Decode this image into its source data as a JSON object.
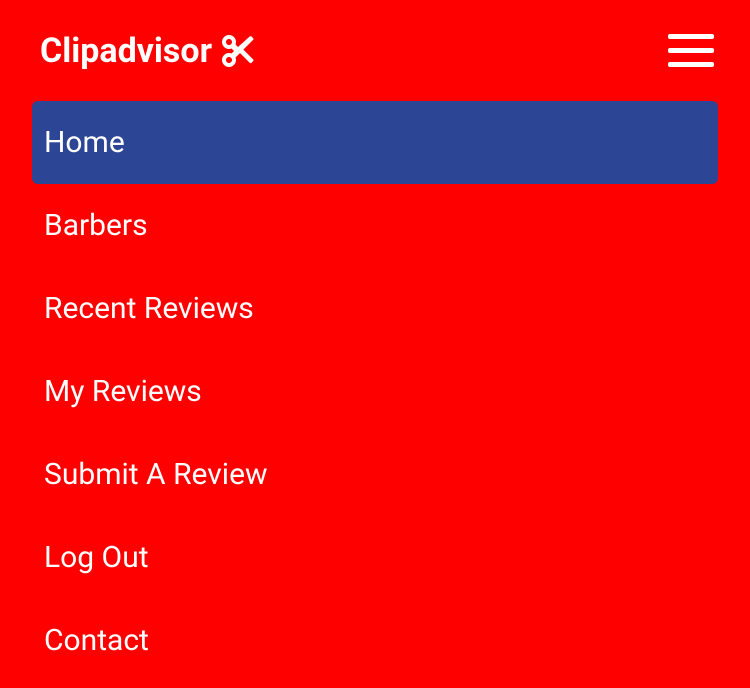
{
  "brand": {
    "name": "Clipadvisor"
  },
  "nav": {
    "items": [
      {
        "label": "Home",
        "active": true
      },
      {
        "label": "Barbers",
        "active": false
      },
      {
        "label": "Recent Reviews",
        "active": false
      },
      {
        "label": "My Reviews",
        "active": false
      },
      {
        "label": "Submit A Review",
        "active": false
      },
      {
        "label": "Log Out",
        "active": false
      },
      {
        "label": "Contact",
        "active": false
      }
    ]
  }
}
